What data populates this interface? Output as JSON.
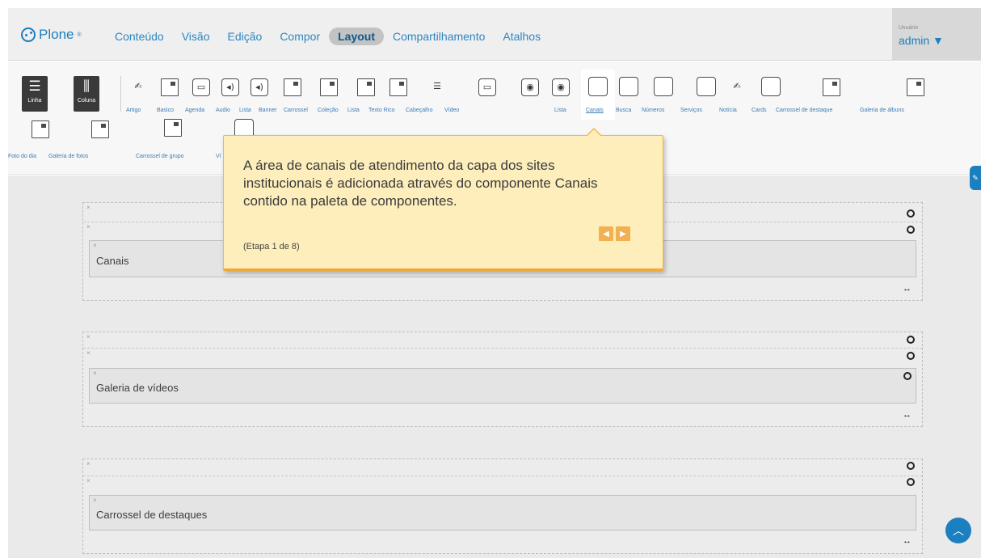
{
  "header": {
    "logo_text": "Plone",
    "logo_sup": "®",
    "nav": [
      {
        "label": "Conteúdo",
        "active": false
      },
      {
        "label": "Visão",
        "active": false
      },
      {
        "label": "Edição",
        "active": false
      },
      {
        "label": "Compor",
        "active": false
      },
      {
        "label": "Layout",
        "active": true
      },
      {
        "label": "Compartilhamento",
        "active": false
      },
      {
        "label": "Atalhos",
        "active": false
      }
    ],
    "user_label": "Usuário",
    "user_name": "admin ▼"
  },
  "palette": {
    "layout_buttons": [
      {
        "label": "Linha",
        "icon": "row-layout-icon"
      },
      {
        "label": "Coluna",
        "icon": "column-layout-icon"
      }
    ],
    "components": [
      {
        "label": "Artigo",
        "icon": "article-icon"
      },
      {
        "label": "Basico",
        "icon": "basic-icon"
      },
      {
        "label": "Agenda",
        "icon": "agenda-icon"
      },
      {
        "label": "Audio",
        "icon": "audio-icon"
      },
      {
        "label": "Lista",
        "icon": "audio-list-icon"
      },
      {
        "label": "Banner",
        "icon": "banner-icon"
      },
      {
        "label": "Carrossel",
        "icon": "carousel-icon"
      },
      {
        "label": "Coleção",
        "icon": "collection-icon"
      },
      {
        "label": "Lista",
        "icon": "list-icon"
      },
      {
        "label": "Texto Rico",
        "icon": "rich-text-icon"
      },
      {
        "label": "Cabeçalho",
        "icon": "header-icon"
      },
      {
        "label": "Vídeo",
        "icon": "video-icon"
      },
      {
        "label": "Lista",
        "icon": "video-list-icon"
      },
      {
        "label": "Canais",
        "icon": "channels-icon"
      },
      {
        "label": "Busca",
        "icon": "search-tile-icon"
      },
      {
        "label": "Números",
        "icon": "numbers-icon"
      },
      {
        "label": "Serviços",
        "icon": "services-icon"
      },
      {
        "label": "Notícia",
        "icon": "news-icon"
      },
      {
        "label": "Cards",
        "icon": "cards-icon"
      },
      {
        "label": "Carrossel de destaque",
        "icon": "featured-carousel-icon"
      },
      {
        "label": "Galeria de álbuns",
        "icon": "album-gallery-icon"
      }
    ],
    "row2_labels": [
      "Foto do dia",
      "Galeria de fotos",
      "Carrossel de grupo",
      "Ví"
    ]
  },
  "tooltip": {
    "text": "A área de canais de atendimento da capa dos sites institucionais é adicionada através do componente Canais contido na paleta de componentes.",
    "step": "(Etapa 1 de 8)",
    "prev": "◀",
    "next": "▶"
  },
  "rows": [
    {
      "x_label": "×",
      "tile_title": "Canais"
    },
    {
      "x_label": "×",
      "tile_title": "Galeria de vídeos"
    },
    {
      "x_label": "×",
      "tile_title": "Carrossel de destaques"
    }
  ],
  "colors": {
    "brand_blue": "#1c7fc0",
    "tooltip_bg": "#fdeebc",
    "tooltip_accent": "#f0b050"
  }
}
